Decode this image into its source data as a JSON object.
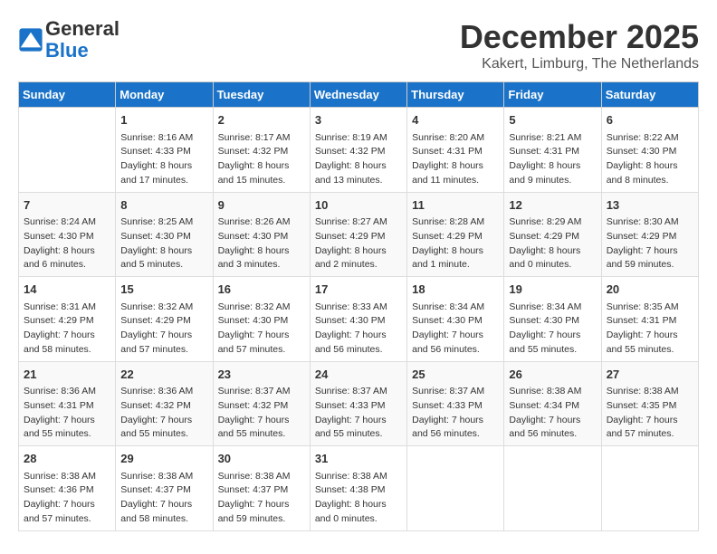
{
  "logo": {
    "line1": "General",
    "line2": "Blue"
  },
  "title": "December 2025",
  "location": "Kakert, Limburg, The Netherlands",
  "weekdays": [
    "Sunday",
    "Monday",
    "Tuesday",
    "Wednesday",
    "Thursday",
    "Friday",
    "Saturday"
  ],
  "weeks": [
    [
      {
        "day": "",
        "info": ""
      },
      {
        "day": "1",
        "info": "Sunrise: 8:16 AM\nSunset: 4:33 PM\nDaylight: 8 hours\nand 17 minutes."
      },
      {
        "day": "2",
        "info": "Sunrise: 8:17 AM\nSunset: 4:32 PM\nDaylight: 8 hours\nand 15 minutes."
      },
      {
        "day": "3",
        "info": "Sunrise: 8:19 AM\nSunset: 4:32 PM\nDaylight: 8 hours\nand 13 minutes."
      },
      {
        "day": "4",
        "info": "Sunrise: 8:20 AM\nSunset: 4:31 PM\nDaylight: 8 hours\nand 11 minutes."
      },
      {
        "day": "5",
        "info": "Sunrise: 8:21 AM\nSunset: 4:31 PM\nDaylight: 8 hours\nand 9 minutes."
      },
      {
        "day": "6",
        "info": "Sunrise: 8:22 AM\nSunset: 4:30 PM\nDaylight: 8 hours\nand 8 minutes."
      }
    ],
    [
      {
        "day": "7",
        "info": "Sunrise: 8:24 AM\nSunset: 4:30 PM\nDaylight: 8 hours\nand 6 minutes."
      },
      {
        "day": "8",
        "info": "Sunrise: 8:25 AM\nSunset: 4:30 PM\nDaylight: 8 hours\nand 5 minutes."
      },
      {
        "day": "9",
        "info": "Sunrise: 8:26 AM\nSunset: 4:30 PM\nDaylight: 8 hours\nand 3 minutes."
      },
      {
        "day": "10",
        "info": "Sunrise: 8:27 AM\nSunset: 4:29 PM\nDaylight: 8 hours\nand 2 minutes."
      },
      {
        "day": "11",
        "info": "Sunrise: 8:28 AM\nSunset: 4:29 PM\nDaylight: 8 hours\nand 1 minute."
      },
      {
        "day": "12",
        "info": "Sunrise: 8:29 AM\nSunset: 4:29 PM\nDaylight: 8 hours\nand 0 minutes."
      },
      {
        "day": "13",
        "info": "Sunrise: 8:30 AM\nSunset: 4:29 PM\nDaylight: 7 hours\nand 59 minutes."
      }
    ],
    [
      {
        "day": "14",
        "info": "Sunrise: 8:31 AM\nSunset: 4:29 PM\nDaylight: 7 hours\nand 58 minutes."
      },
      {
        "day": "15",
        "info": "Sunrise: 8:32 AM\nSunset: 4:29 PM\nDaylight: 7 hours\nand 57 minutes."
      },
      {
        "day": "16",
        "info": "Sunrise: 8:32 AM\nSunset: 4:30 PM\nDaylight: 7 hours\nand 57 minutes."
      },
      {
        "day": "17",
        "info": "Sunrise: 8:33 AM\nSunset: 4:30 PM\nDaylight: 7 hours\nand 56 minutes."
      },
      {
        "day": "18",
        "info": "Sunrise: 8:34 AM\nSunset: 4:30 PM\nDaylight: 7 hours\nand 56 minutes."
      },
      {
        "day": "19",
        "info": "Sunrise: 8:34 AM\nSunset: 4:30 PM\nDaylight: 7 hours\nand 55 minutes."
      },
      {
        "day": "20",
        "info": "Sunrise: 8:35 AM\nSunset: 4:31 PM\nDaylight: 7 hours\nand 55 minutes."
      }
    ],
    [
      {
        "day": "21",
        "info": "Sunrise: 8:36 AM\nSunset: 4:31 PM\nDaylight: 7 hours\nand 55 minutes."
      },
      {
        "day": "22",
        "info": "Sunrise: 8:36 AM\nSunset: 4:32 PM\nDaylight: 7 hours\nand 55 minutes."
      },
      {
        "day": "23",
        "info": "Sunrise: 8:37 AM\nSunset: 4:32 PM\nDaylight: 7 hours\nand 55 minutes."
      },
      {
        "day": "24",
        "info": "Sunrise: 8:37 AM\nSunset: 4:33 PM\nDaylight: 7 hours\nand 55 minutes."
      },
      {
        "day": "25",
        "info": "Sunrise: 8:37 AM\nSunset: 4:33 PM\nDaylight: 7 hours\nand 56 minutes."
      },
      {
        "day": "26",
        "info": "Sunrise: 8:38 AM\nSunset: 4:34 PM\nDaylight: 7 hours\nand 56 minutes."
      },
      {
        "day": "27",
        "info": "Sunrise: 8:38 AM\nSunset: 4:35 PM\nDaylight: 7 hours\nand 57 minutes."
      }
    ],
    [
      {
        "day": "28",
        "info": "Sunrise: 8:38 AM\nSunset: 4:36 PM\nDaylight: 7 hours\nand 57 minutes."
      },
      {
        "day": "29",
        "info": "Sunrise: 8:38 AM\nSunset: 4:37 PM\nDaylight: 7 hours\nand 58 minutes."
      },
      {
        "day": "30",
        "info": "Sunrise: 8:38 AM\nSunset: 4:37 PM\nDaylight: 7 hours\nand 59 minutes."
      },
      {
        "day": "31",
        "info": "Sunrise: 8:38 AM\nSunset: 4:38 PM\nDaylight: 8 hours\nand 0 minutes."
      },
      {
        "day": "",
        "info": ""
      },
      {
        "day": "",
        "info": ""
      },
      {
        "day": "",
        "info": ""
      }
    ]
  ]
}
